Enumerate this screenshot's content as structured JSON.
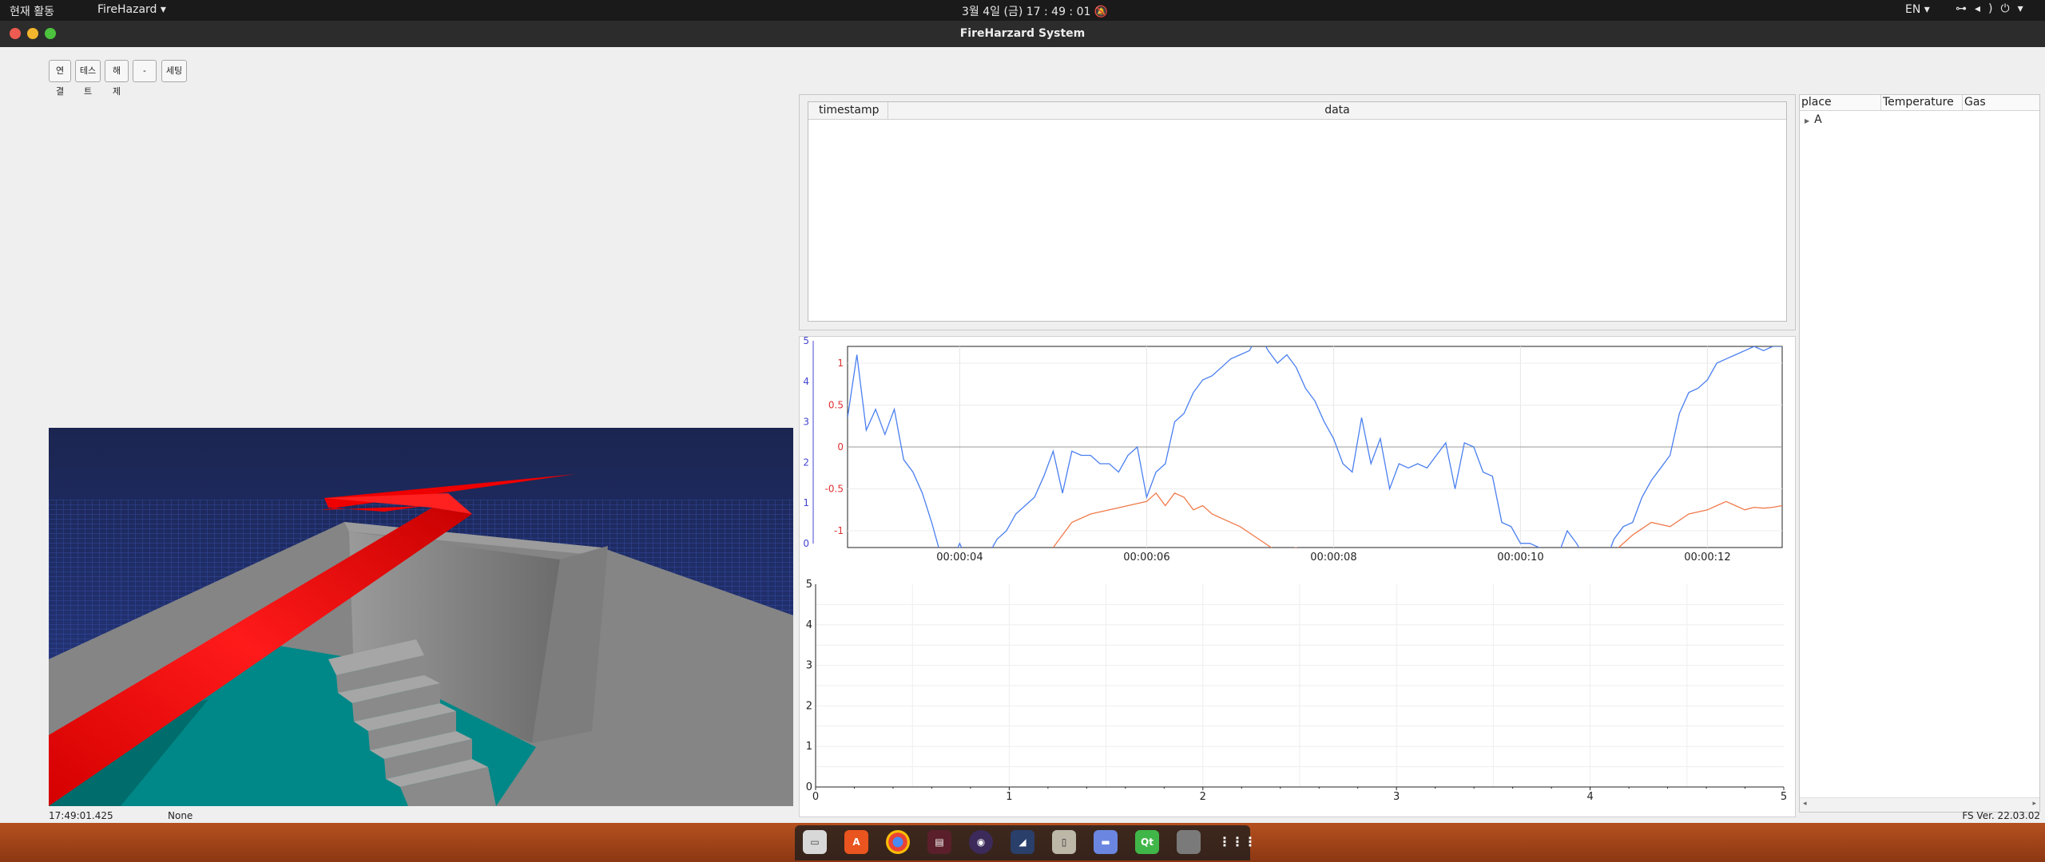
{
  "topbar": {
    "activities": "현재 활동",
    "app_menu": "FireHazard ▾",
    "clock": "3월 4일 (금)  17 : 49 : 01",
    "lang": "EN ▾"
  },
  "window": {
    "title": "FireHarzard System"
  },
  "toolbar": {
    "connect": "연결",
    "test": "테스트",
    "release": "해제",
    "dash": "-",
    "settings": "세팅"
  },
  "log_table": {
    "columns": [
      "timestamp",
      "data"
    ]
  },
  "sensor_tree": {
    "columns": [
      "place",
      "Temperature",
      "Gas"
    ],
    "rows": [
      {
        "place": "A"
      }
    ]
  },
  "status": {
    "time": "17:49:01.425",
    "state": "None",
    "version": "FS Ver. 22.03.02"
  },
  "colors": {
    "series_blue": "#4a7ff0",
    "series_orange": "#f07a4a",
    "axis_left": "#4545d0",
    "axis_inner": "#e03030"
  },
  "chart_data": [
    {
      "type": "line",
      "x_tick_labels": [
        "00:00:04",
        "00:00:06",
        "00:00:08",
        "00:00:10",
        "00:00:12"
      ],
      "y_left_ticks": [
        "0",
        "1",
        "2",
        "3",
        "4",
        "5"
      ],
      "y_right_ticks": [
        "1",
        "0.5",
        "0",
        "-0.5",
        "-1"
      ],
      "ylim_left": [
        0,
        5
      ],
      "ylim_inner": [
        -1.2,
        1.2
      ],
      "grid": true,
      "series": [
        {
          "color": "blue",
          "x": [
            2.8,
            2.9,
            3.0,
            3.1,
            3.2,
            3.3,
            3.4,
            3.5,
            3.6,
            3.7,
            3.8,
            3.9,
            4.0,
            4.1,
            4.2,
            4.3,
            4.4,
            4.5,
            4.6,
            4.7,
            4.8,
            4.9,
            5.0,
            5.1,
            5.2,
            5.3,
            5.4,
            5.5,
            5.6,
            5.7,
            5.8,
            5.9,
            6.0,
            6.1,
            6.2,
            6.3,
            6.4,
            6.5,
            6.6,
            6.7,
            6.8,
            6.9,
            7.0,
            7.1,
            7.2,
            7.3,
            7.4,
            7.5,
            7.6,
            7.7,
            7.8,
            7.9,
            8.0,
            8.1,
            8.2,
            8.3,
            8.4,
            8.5,
            8.6,
            8.7,
            8.8,
            8.9,
            9.0,
            9.1,
            9.2,
            9.3,
            9.4,
            9.5,
            9.6,
            9.7,
            9.8,
            9.9,
            10.0,
            10.1,
            10.2,
            10.3,
            10.4,
            10.5,
            10.6,
            10.7,
            10.8,
            10.9,
            11.0,
            11.1,
            11.2,
            11.3,
            11.4,
            11.5,
            11.6,
            11.7,
            11.8,
            11.9,
            12.0,
            12.1,
            12.2,
            12.3,
            12.4,
            12.5,
            12.6,
            12.7,
            12.8
          ],
          "values": [
            0.35,
            1.1,
            0.2,
            0.45,
            0.15,
            0.45,
            -0.15,
            -0.3,
            -0.55,
            -0.9,
            -1.3,
            -1.4,
            -1.15,
            -1.4,
            -1.35,
            -1.3,
            -1.1,
            -1.0,
            -0.8,
            -0.7,
            -0.6,
            -0.35,
            -0.05,
            -0.55,
            -0.05,
            -0.1,
            -0.1,
            -0.2,
            -0.2,
            -0.3,
            -0.1,
            0,
            -0.6,
            -0.3,
            -0.2,
            0.3,
            0.4,
            0.65,
            0.8,
            0.85,
            0.95,
            1.05,
            1.1,
            1.15,
            1.35,
            1.15,
            1.0,
            1.1,
            0.95,
            0.7,
            0.55,
            0.3,
            0.1,
            -0.2,
            -0.3,
            0.35,
            -0.2,
            0.1,
            -0.5,
            -0.2,
            -0.25,
            -0.2,
            -0.25,
            -0.1,
            0.05,
            -0.5,
            0.05,
            0.0,
            -0.3,
            -0.35,
            -0.9,
            -0.95,
            -1.15,
            -1.15,
            -1.2,
            -1.4,
            -1.3,
            -1.0,
            -1.15,
            -1.35,
            -1.2,
            -1.4,
            -1.1,
            -0.95,
            -0.9,
            -0.6,
            -0.4,
            -0.25,
            -0.1,
            0.4,
            0.65,
            0.7,
            0.8,
            1.0,
            1.05,
            1.1,
            1.15,
            1.2,
            1.15,
            1.2,
            1.2
          ]
        },
        {
          "color": "orange",
          "x": [
            5.0,
            5.2,
            5.4,
            5.6,
            5.8,
            6.0,
            6.1,
            6.2,
            6.3,
            6.4,
            6.5,
            6.6,
            6.7,
            6.8,
            7.0,
            7.2,
            7.4,
            7.6,
            7.8,
            11.0,
            11.2,
            11.4,
            11.6,
            11.8,
            12.0,
            12.1,
            12.2,
            12.3,
            12.4,
            12.5,
            12.6,
            12.7,
            12.8
          ],
          "values": [
            -1.2,
            -0.9,
            -0.8,
            -0.75,
            -0.7,
            -0.65,
            -0.55,
            -0.7,
            -0.55,
            -0.6,
            -0.75,
            -0.7,
            -0.8,
            -0.85,
            -0.95,
            -1.1,
            -1.25,
            -1.2,
            -1.3,
            -1.25,
            -1.05,
            -0.9,
            -0.95,
            -0.8,
            -0.75,
            -0.7,
            -0.65,
            -0.7,
            -0.75,
            -0.72,
            -0.73,
            -0.72,
            -0.7
          ]
        }
      ]
    },
    {
      "type": "line",
      "x_tick_labels": [
        "0",
        "1",
        "2",
        "3",
        "4",
        "5"
      ],
      "y_tick_labels": [
        "0",
        "1",
        "2",
        "3",
        "4",
        "5"
      ],
      "xlim": [
        0,
        5
      ],
      "ylim": [
        0,
        5
      ],
      "grid": true,
      "series": []
    }
  ]
}
